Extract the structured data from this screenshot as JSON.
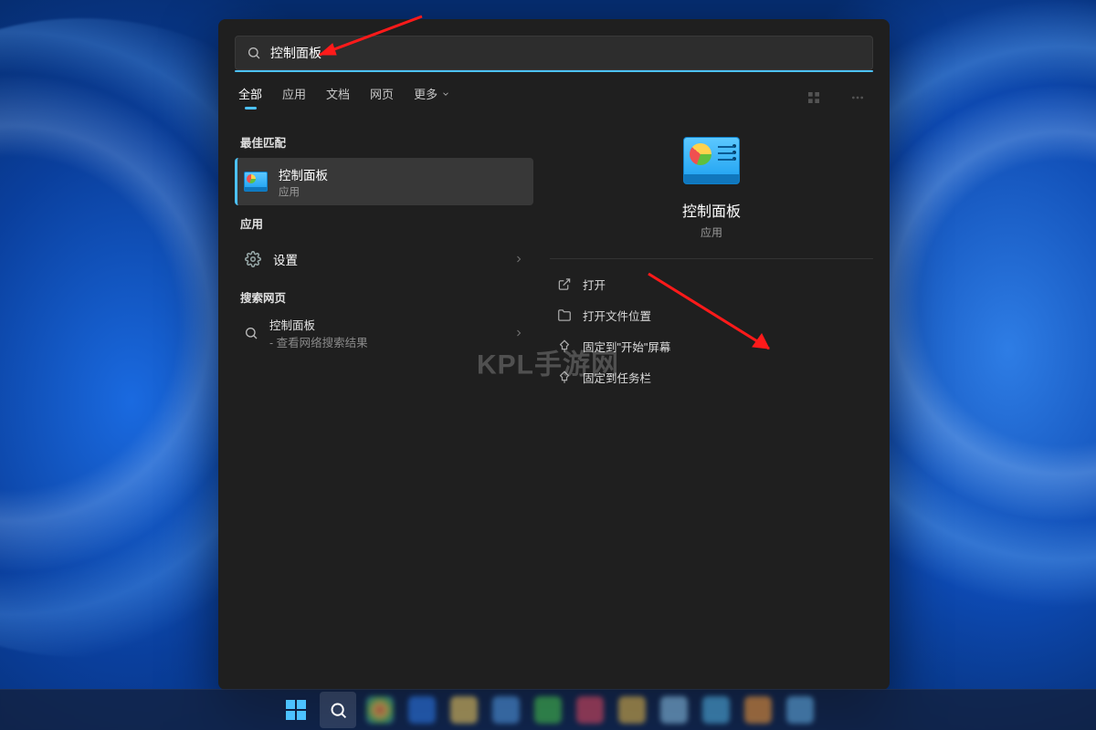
{
  "search": {
    "query": "控制面板"
  },
  "filters": {
    "all": "全部",
    "apps": "应用",
    "docs": "文档",
    "web": "网页",
    "more": "更多"
  },
  "sections": {
    "best_match": "最佳匹配",
    "apps": "应用",
    "web": "搜索网页"
  },
  "best": {
    "title": "控制面板",
    "subtitle": "应用"
  },
  "app_item": {
    "title": "设置"
  },
  "web_item": {
    "term": "控制面板",
    "suffix": " - 查看网络搜索结果"
  },
  "detail": {
    "title": "控制面板",
    "subtitle": "应用"
  },
  "actions": {
    "open": "打开",
    "open_loc": "打开文件位置",
    "pin_start": "固定到\"开始\"屏幕",
    "pin_taskbar": "固定到任务栏"
  },
  "watermark": "KPL手游网"
}
